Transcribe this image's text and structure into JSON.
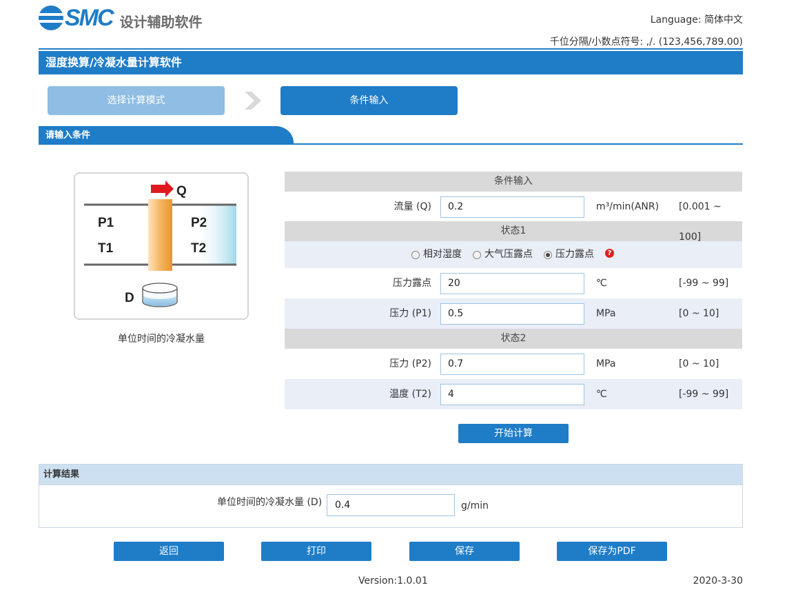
{
  "header": {
    "logo_text": "SMC",
    "app_name": "设计辅助软件",
    "language_label": "Language:",
    "language_value": "简体中文",
    "separator_label": "千位分隔/小数点符号:",
    "separator_value": ",/. (123,456,789.00)"
  },
  "title": "湿度换算/冷凝水量计算软件",
  "steps": [
    {
      "label": "选择计算模式",
      "state": "done"
    },
    {
      "label": "条件输入",
      "state": "active"
    }
  ],
  "section_title": "请输入条件",
  "diagram": {
    "labels": {
      "q": "Q",
      "p1": "P1",
      "t1": "T1",
      "p2": "P2",
      "t2": "T2",
      "d": "D"
    },
    "caption": "单位时间的冷凝水量"
  },
  "form": {
    "header": "条件输入",
    "flow": {
      "label": "流量 (Q)",
      "value": "0.2",
      "unit": "m³/min(ANR)",
      "range": "[0.001 ~ 100]"
    },
    "state1": {
      "header": "状态1",
      "radio_options": [
        {
          "label": "相对湿度",
          "selected": false
        },
        {
          "label": "大气压露点",
          "selected": false
        },
        {
          "label": "压力露点",
          "selected": true
        }
      ],
      "help_icon": "?",
      "dew_point": {
        "label": "压力露点",
        "value": "20",
        "unit": "℃",
        "range": "[-99 ~ 99]"
      },
      "pressure": {
        "label": "压力 (P1)",
        "value": "0.5",
        "unit": "MPa",
        "range": "[0 ~ 10]"
      }
    },
    "state2": {
      "header": "状态2",
      "pressure": {
        "label": "压力 (P2)",
        "value": "0.7",
        "unit": "MPa",
        "range": "[0 ~ 10]"
      },
      "temperature": {
        "label": "温度 (T2)",
        "value": "4",
        "unit": "℃",
        "range": "[-99 ~ 99]"
      }
    }
  },
  "calc_button": "开始计算",
  "result": {
    "header": "计算结果",
    "label": "单位时间的冷凝水量 (D)",
    "value": "0.4",
    "unit": "g/min"
  },
  "actions": {
    "back": "返回",
    "print": "打印",
    "save": "保存",
    "save_pdf": "保存为PDF"
  },
  "footer": {
    "version": "Version:1.0.01",
    "date": "2020-3-30"
  },
  "colors": {
    "brand_blue": "#1f7cc7",
    "step_done": "#8fbde3",
    "header_gray": "#d9d9d9",
    "row_alt": "#e9eef7",
    "arrow_red": "#e0191f",
    "filter_orange": "#f0a040"
  }
}
